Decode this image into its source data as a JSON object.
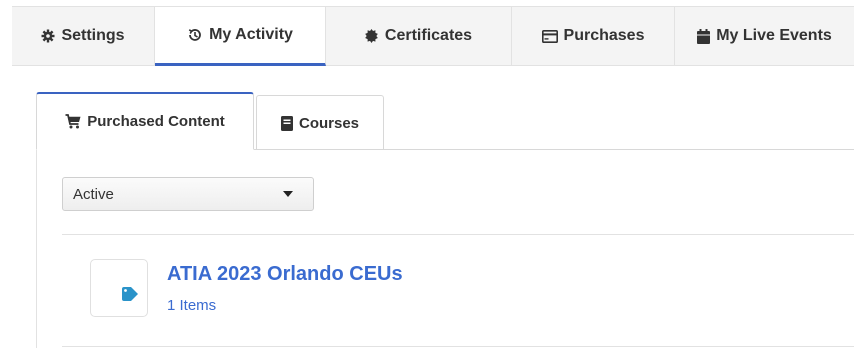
{
  "topnav": {
    "tabs": [
      {
        "label": "Settings",
        "icon": "gear-icon"
      },
      {
        "label": "My Activity",
        "icon": "history-icon",
        "active": true
      },
      {
        "label": "Certificates",
        "icon": "certificate-icon"
      },
      {
        "label": "Purchases",
        "icon": "credit-card-icon"
      },
      {
        "label": "My Live Events",
        "icon": "calendar-icon"
      }
    ]
  },
  "subtabs": {
    "purchased": {
      "label": "Purchased Content",
      "icon": "cart-icon",
      "active": true
    },
    "courses": {
      "label": "Courses",
      "icon": "book-icon"
    }
  },
  "filter": {
    "selected": "Active"
  },
  "items": [
    {
      "title": "ATIA 2023 Orlando CEUs",
      "subtitle": "1 Items",
      "icon": "tag-icon"
    }
  ],
  "colors": {
    "accent": "#3a63c1",
    "link": "#3a6bd0",
    "tag": "#2a93c9"
  }
}
